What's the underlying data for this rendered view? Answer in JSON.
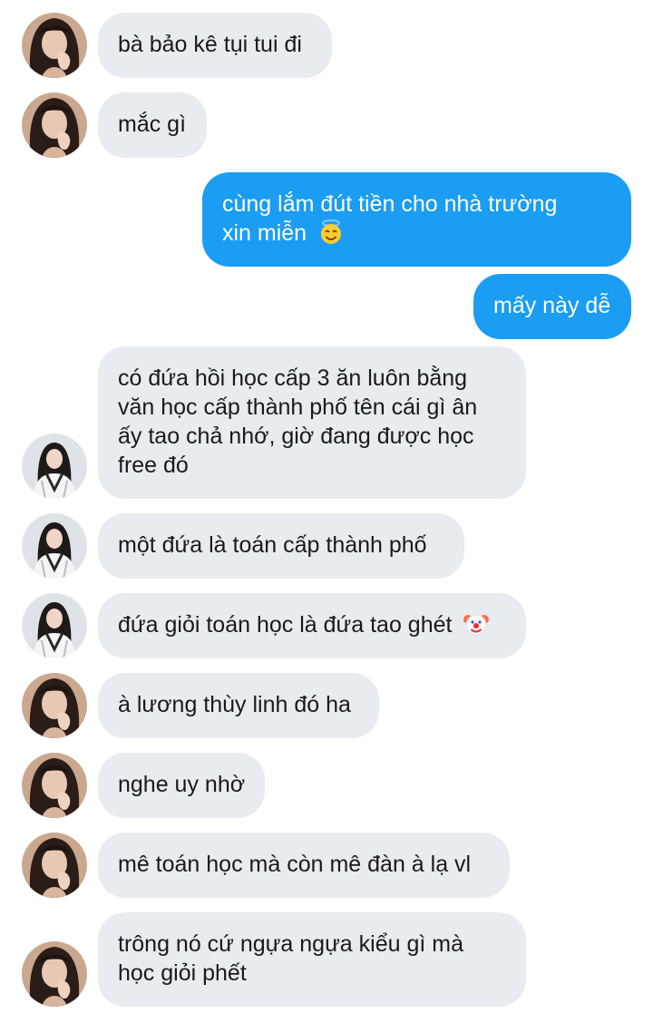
{
  "conversation": {
    "messages": [
      {
        "sender": "them",
        "avatar": "avatar-a",
        "text": "bà bảo kê tụi tui đi"
      },
      {
        "sender": "them",
        "avatar": "avatar-a",
        "text": "mắc gì"
      },
      {
        "sender": "me",
        "line1": "cùng lắm đút tiền cho nhà trường",
        "line2": "xin miễn",
        "emoji": "smiling-face-with-halo-emoji"
      },
      {
        "sender": "me",
        "text": "mấy này dễ"
      },
      {
        "sender": "them",
        "avatar": "avatar-b",
        "lines": [
          "có đứa hồi học cấp 3 ăn luôn bằng",
          "văn học cấp thành phố tên cái gì ân",
          "ấy tao chả nhớ, giờ đang được học",
          "free đó"
        ]
      },
      {
        "sender": "them",
        "avatar": "avatar-b",
        "text": "một đứa là toán cấp thành phố"
      },
      {
        "sender": "them",
        "avatar": "avatar-b",
        "text": "đứa giỏi toán học là đứa tao ghét",
        "emoji": "clown-face-emoji"
      },
      {
        "sender": "them",
        "avatar": "avatar-a",
        "text": "à lương thùy linh đó ha"
      },
      {
        "sender": "them",
        "avatar": "avatar-a",
        "text": "nghe uy nhờ"
      },
      {
        "sender": "them",
        "avatar": "avatar-a",
        "text": "mê toán học mà còn mê đàn à lạ vl"
      },
      {
        "sender": "them",
        "avatar": "avatar-a",
        "lines": [
          "trông nó cứ ngựa ngựa kiểu gì mà",
          "học giỏi phết"
        ]
      }
    ]
  },
  "colors": {
    "incoming_bubble": "#e8ebef",
    "outgoing_bubble": "#1a9df2",
    "incoming_text": "#1a1a1a",
    "outgoing_text": "#ffffff"
  }
}
